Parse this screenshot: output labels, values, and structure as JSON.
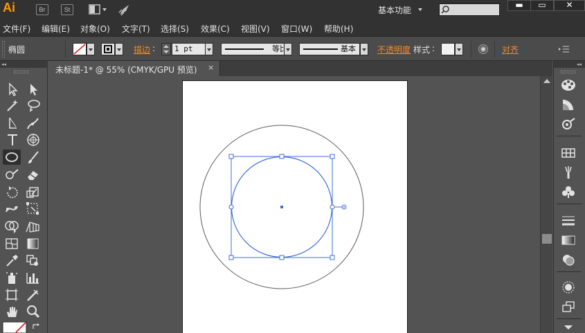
{
  "app": {
    "logo": "Ai",
    "bridge_button": "Br",
    "stock_button": "St",
    "workspace_label": "基本功能",
    "window_buttons": {
      "minimize": "▬",
      "maximize": "▭",
      "close": "✕"
    }
  },
  "menu": [
    "文件(F)",
    "编辑(E)",
    "对象(O)",
    "文字(T)",
    "选择(S)",
    "效果(C)",
    "视图(V)",
    "窗口(W)",
    "帮助(H)"
  ],
  "control_bar": {
    "object_type": "椭圆",
    "stroke_label": "描边",
    "stroke_weight": "1 pt",
    "stroke_profile": "等比",
    "brush_label": "基本",
    "opacity_label": "不透明度",
    "style_label": "样式",
    "align_label": "对齐"
  },
  "document": {
    "tab_title": "未标题-1* @ 55% (CMYK/GPU 预览)",
    "tab_close": "×"
  },
  "colors": {
    "accent_orange": "#ff9a00",
    "selection_blue": "#3e6cd8",
    "chrome_dark": "#323232",
    "panel_gray": "#535353"
  },
  "tools": [
    "selection-tool",
    "direct-selection-tool",
    "magic-wand-tool",
    "lasso-tool",
    "pen-tool",
    "curvature-tool",
    "type-tool",
    "polar-grid-tool",
    "ellipse-tool",
    "paintbrush-tool",
    "shaper-tool",
    "eraser-tool",
    "rotate-tool",
    "scale-tool",
    "puppet-warp-tool",
    "free-transform-tool",
    "shape-builder-tool",
    "perspective-grid-tool",
    "mesh-tool",
    "gradient-tool",
    "eyedropper-tool",
    "blend-tool",
    "symbol-sprayer-tool",
    "column-graph-tool",
    "artboard-tool",
    "slice-tool",
    "hand-tool",
    "zoom-tool"
  ],
  "right_panels": [
    "color-panel",
    "color-guide-panel",
    "stroke-curve-panel",
    "swatches-panel",
    "brushes-panel",
    "symbols-panel",
    "stroke-panel",
    "gradient-panel",
    "transparency-panel",
    "appearance-panel",
    "layers-panel"
  ]
}
